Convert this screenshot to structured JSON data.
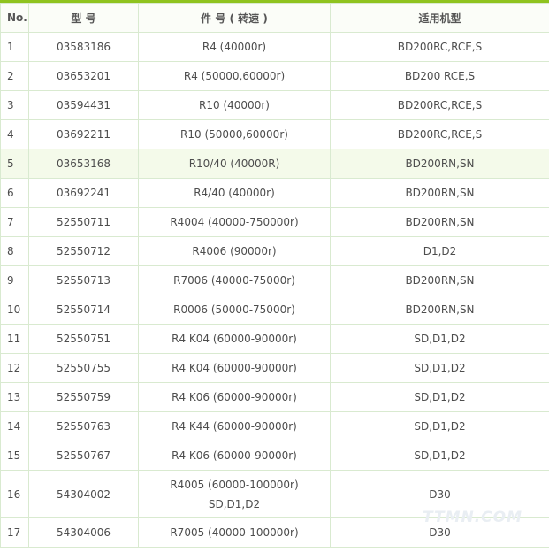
{
  "header": {
    "no": "No.",
    "model": "型 号",
    "part": "件 号 ( 转速 )",
    "machine": "适用机型"
  },
  "rows": [
    {
      "no": "1",
      "model": "03583186",
      "part": "R4 (40000r)",
      "machine": "BD200RC,RCE,S"
    },
    {
      "no": "2",
      "model": "03653201",
      "part": "R4 (50000,60000r)",
      "machine": "BD200 RCE,S"
    },
    {
      "no": "3",
      "model": "03594431",
      "part": "R10 (40000r)",
      "machine": "BD200RC,RCE,S"
    },
    {
      "no": "4",
      "model": "03692211",
      "part": "R10 (50000,60000r)",
      "machine": "BD200RC,RCE,S"
    },
    {
      "no": "5",
      "model": "03653168",
      "part": "R10/40 (40000R)",
      "machine": "BD200RN,SN"
    },
    {
      "no": "6",
      "model": "03692241",
      "part": "R4/40 (40000r)",
      "machine": "BD200RN,SN"
    },
    {
      "no": "7",
      "model": "52550711",
      "part": "R4004 (40000-750000r)",
      "machine": "BD200RN,SN"
    },
    {
      "no": "8",
      "model": "52550712",
      "part": "R4006 (90000r)",
      "machine": "D1,D2"
    },
    {
      "no": "9",
      "model": "52550713",
      "part": "R7006 (40000-75000r)",
      "machine": "BD200RN,SN"
    },
    {
      "no": "10",
      "model": "52550714",
      "part": "R0006 (50000-75000r)",
      "machine": "BD200RN,SN"
    },
    {
      "no": "11",
      "model": "52550751",
      "part": "R4 K04 (60000-90000r)",
      "machine": "SD,D1,D2"
    },
    {
      "no": "12",
      "model": "52550755",
      "part": "R4 K04 (60000-90000r)",
      "machine": "SD,D1,D2"
    },
    {
      "no": "13",
      "model": "52550759",
      "part": "R4 K06 (60000-90000r)",
      "machine": "SD,D1,D2"
    },
    {
      "no": "14",
      "model": "52550763",
      "part": "R4 K44 (60000-90000r)",
      "machine": "SD,D1,D2"
    },
    {
      "no": "15",
      "model": "52550767",
      "part": "R4 K06 (60000-90000r)",
      "machine": "SD,D1,D2"
    },
    {
      "no": "16",
      "model": "54304002",
      "part": "R4005 (60000-100000r)",
      "part2": "SD,D1,D2",
      "machine": "D30"
    },
    {
      "no": "17",
      "model": "54304006",
      "part": "R7005 (40000-100000r)",
      "machine": "D30"
    }
  ],
  "watermark": "TTMN.COM"
}
